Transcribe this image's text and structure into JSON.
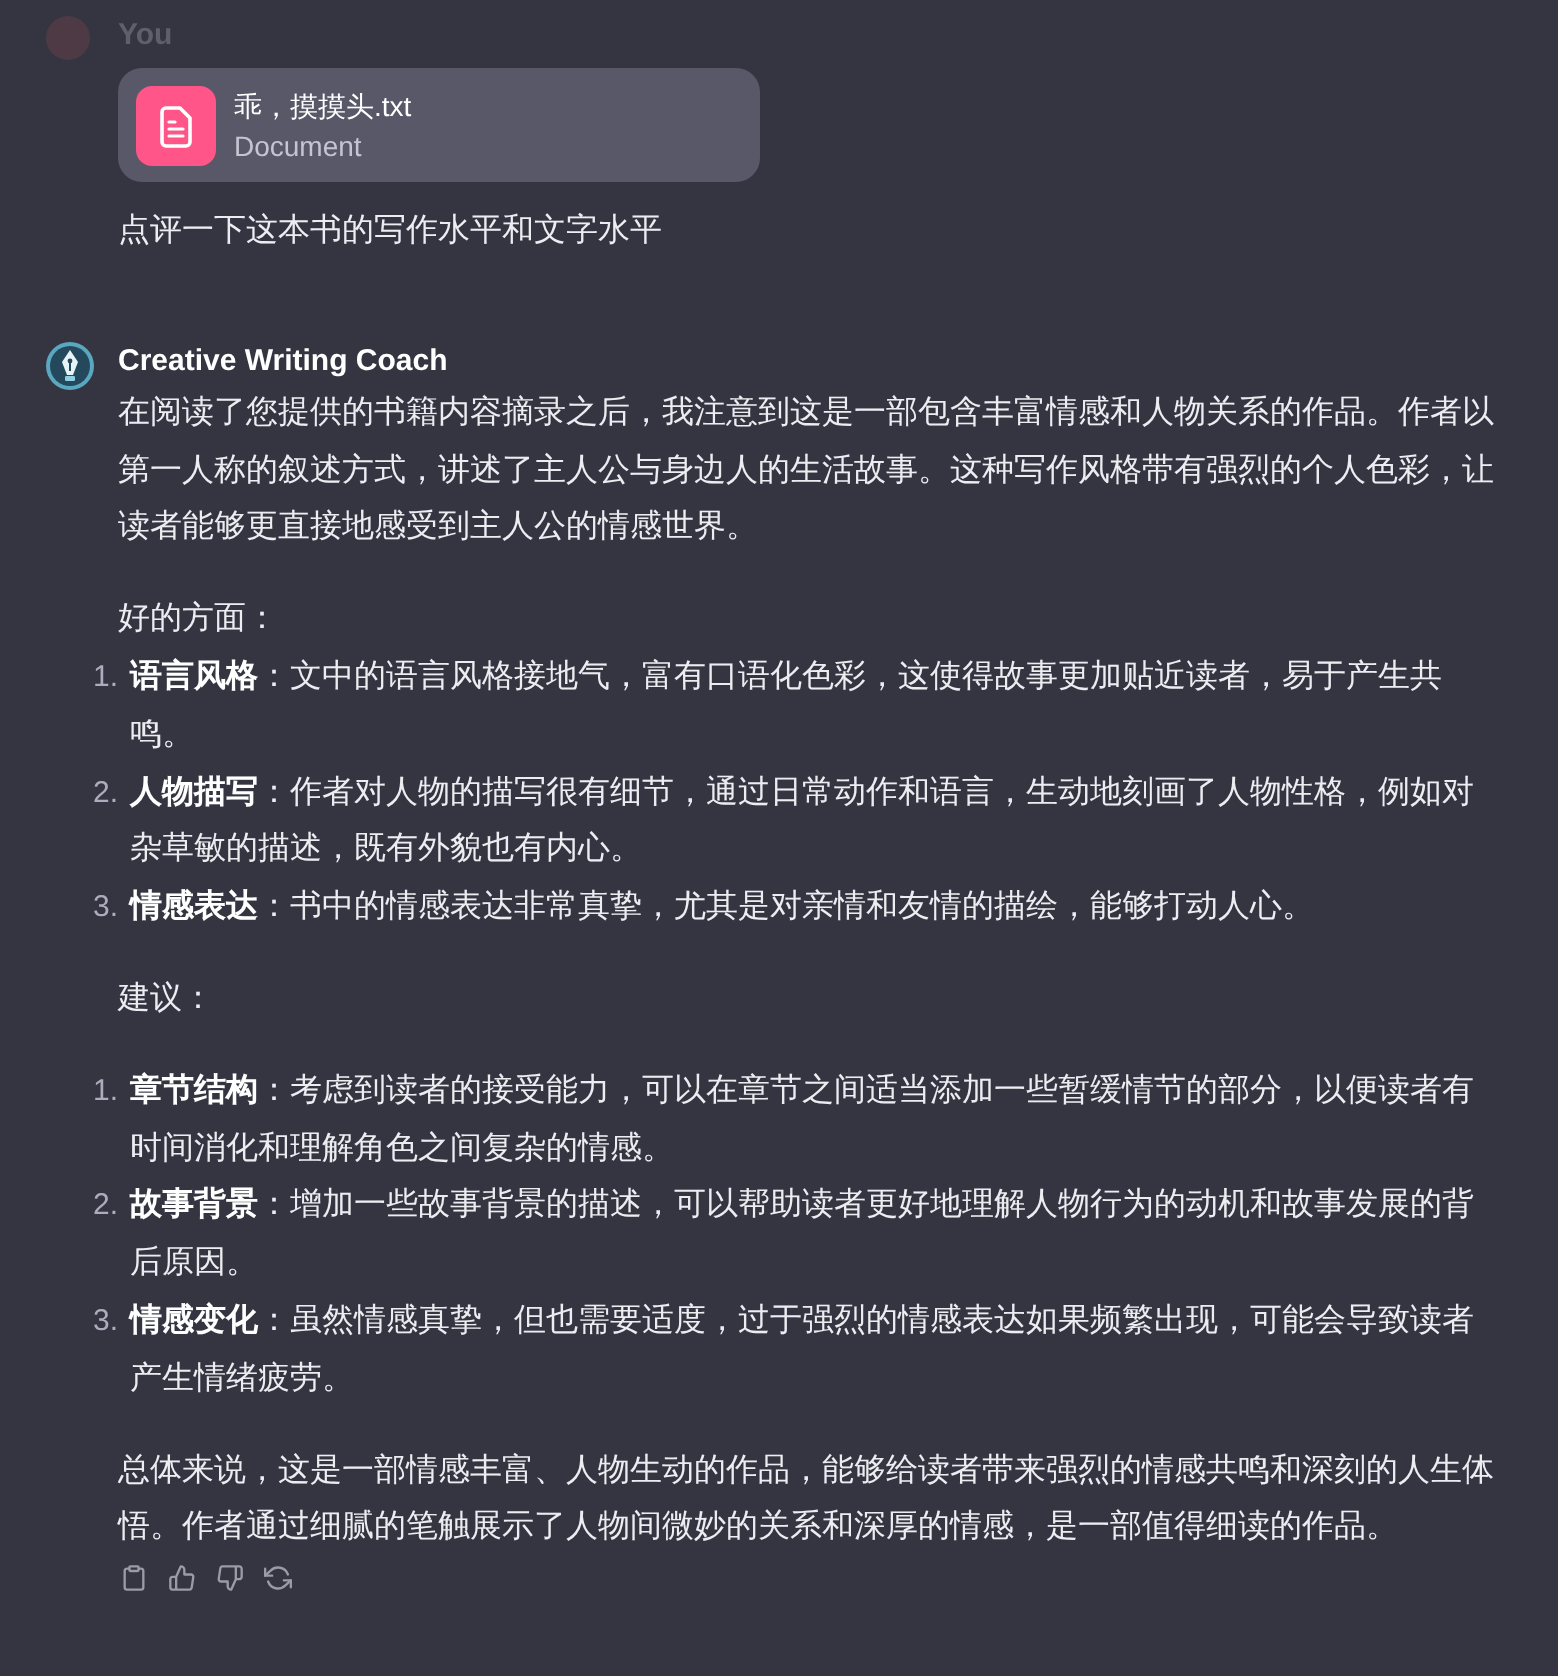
{
  "conversation": [
    {
      "kind": "user",
      "author": "You",
      "attachment": {
        "name": "乖，摸摸头.txt",
        "type": "Document"
      },
      "text": "点评一下这本书的写作水平和文字水平"
    },
    {
      "kind": "assistant",
      "author": "Creative Writing Coach",
      "blocks": [
        {
          "kind": "paragraph",
          "text": "在阅读了您提供的书籍内容摘录之后，我注意到这是一部包含丰富情感和人物关系的作品。作者以第一人称的叙述方式，讲述了主人公与身边人的生活故事。这种写作风格带有强烈的个人色彩，让读者能够更直接地感受到主人公的情感世界。"
        },
        {
          "kind": "paragraph",
          "text": "好的方面："
        },
        {
          "kind": "list",
          "items": [
            {
              "number": "1.",
              "text": "**语言风格**：文中的语言风格接地气，富有口语化色彩，这使得故事更加贴近读者，易于产生共鸣。"
            },
            {
              "number": "2.",
              "text": "**人物描写**：作者对人物的描写很有细节，通过日常动作和语言，生动地刻画了人物性格，例如对杂草敏的描述，既有外貌也有内心。"
            },
            {
              "number": "3.",
              "text": "**情感表达**：书中的情感表达非常真挚，尤其是对亲情和友情的描绘，能够打动人心。"
            }
          ]
        },
        {
          "kind": "paragraph",
          "text": "建议："
        },
        {
          "kind": "list",
          "items": [
            {
              "number": "1.",
              "text": "**章节结构**：考虑到读者的接受能力，可以在章节之间适当添加一些暂缓情节的部分，以便读者有时间消化和理解角色之间复杂的情感。"
            },
            {
              "number": "2.",
              "text": "**故事背景**：增加一些故事背景的描述，可以帮助读者更好地理解人物行为的动机和故事发展的背后原因。"
            },
            {
              "number": "3.",
              "text": "**情感变化**：虽然情感真挚，但也需要适度，过于强烈的情感表达如果频繁出现，可能会导致读者产生情绪疲劳。"
            }
          ]
        },
        {
          "kind": "paragraph",
          "text": "总体来说，这是一部情感丰富、人物生动的作品，能够给读者带来强烈的情感共鸣和深刻的人生体悟。作者通过细腻的笔触展示了人物间微妙的关系和深厚的情感，是一部值得细读的作品。"
        }
      ]
    }
  ]
}
